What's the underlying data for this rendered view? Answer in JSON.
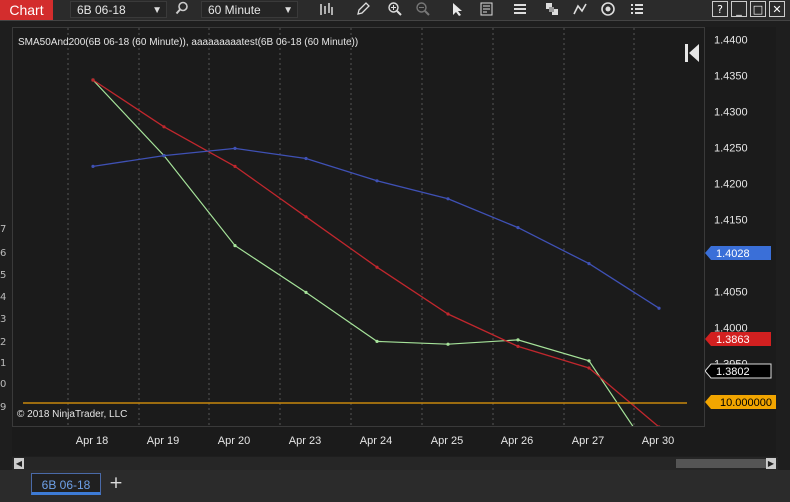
{
  "toolbar": {
    "chart_label": "Chart",
    "instrument": "6B 06-18",
    "interval": "60 Minute"
  },
  "chart": {
    "indicator_label": "SMA50And200(6B 06-18 (60 Minute)), aaaaaaaaatest(6B 06-18 (60 Minute))",
    "copyright": "© 2018 NinjaTrader, LLC",
    "x_labels": [
      "Apr 18",
      "Apr 19",
      "Apr 20",
      "Apr 23",
      "Apr 24",
      "Apr 25",
      "Apr 26",
      "Apr 27",
      "Apr 30"
    ],
    "y_labels": [
      "1.4400",
      "1.4350",
      "1.4300",
      "1.4250",
      "1.4200",
      "1.4150",
      "1.4100",
      "1.4050",
      "1.4000",
      "1.3950",
      "1.3900"
    ],
    "markers": {
      "sma200": "1.4028",
      "sma50": "1.3863",
      "last_price": "1.3802",
      "test_value": "10.000000"
    },
    "left_edge_labels": [
      "7",
      "6",
      "5",
      "4",
      "3",
      "2",
      "1",
      "0",
      "9"
    ],
    "colors": {
      "sma50": "#c0272d",
      "sma200": "#3f51b5",
      "candle_up": "#a6e39a",
      "candle_down": "#e8e8e8",
      "test_line": "#c8870d",
      "sma200_marker": "#3a6fd8",
      "sma50_marker": "#d22020",
      "test_marker": "#f2a500"
    }
  },
  "chart_data": {
    "type": "line",
    "x": [
      "Apr 18",
      "Apr 19",
      "Apr 20",
      "Apr 23",
      "Apr 24",
      "Apr 25",
      "Apr 26",
      "Apr 27",
      "Apr 30"
    ],
    "ylim": [
      1.387,
      1.4413
    ],
    "series": [
      {
        "name": "",
        "values": [
          1.4345,
          1.424,
          1.4115,
          1.405,
          1.3982,
          1.3978,
          1.3984,
          1.3955,
          1.381
        ]
      },
      {
        "name": "",
        "values": [
          1.4345,
          1.428,
          1.4225,
          1.4155,
          1.4085,
          1.402,
          1.3975,
          1.3945,
          1.3863
        ]
      },
      {
        "name": "",
        "values": [
          1.4225,
          1.424,
          1.425,
          1.4236,
          1.4205,
          1.418,
          1.414,
          1.409,
          1.4028
        ]
      }
    ]
  },
  "tabs": {
    "active": "6B 06-18",
    "add_label": "+"
  }
}
